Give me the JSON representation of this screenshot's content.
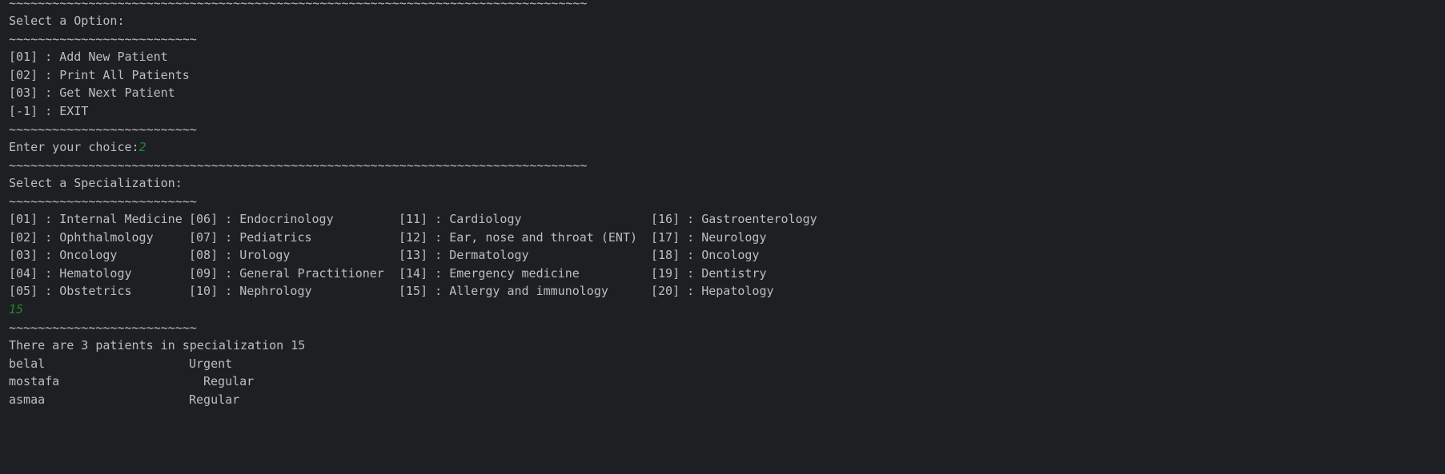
{
  "console": {
    "rule_long": "~~~~~~~~~~~~~~~~~~~~~~~~~~~~~~~~~~~~~~~~~~~~~~~~~~~~~~~~~~~~~~~~~~~~~~~~~~~~~~~~",
    "rule_short": "~~~~~~~~~~~~~~~~~~~~~~~~~~",
    "option_prompt": "Select a Option:",
    "options": [
      "[01] : Add New Patient",
      "[02] : Print All Patients",
      "[03] : Get Next Patient",
      "[-1] : EXIT"
    ],
    "choice_prompt": "Enter your choice:",
    "choice_input": "2",
    "spec_prompt": "Select a Specialization:",
    "specializations": [
      [
        "[01] : Internal Medicine",
        "[06] : Endocrinology",
        "[11] : Cardiology",
        "[16] : Gastroenterology"
      ],
      [
        "[02] : Ophthalmology",
        "[07] : Pediatrics",
        "[12] : Ear, nose and throat (ENT)",
        "[17] : Neurology"
      ],
      [
        "[03] : Oncology",
        "[08] : Urology",
        "[13] : Dermatology",
        "[18] : Oncology"
      ],
      [
        "[04] : Hematology",
        "[09] : General Practitioner",
        "[14] : Emergency medicine",
        "[19] : Dentistry"
      ],
      [
        "[05] : Obstetrics",
        "[10] : Nephrology",
        "[15] : Allergy and immunology",
        "[20] : Hepatology"
      ]
    ],
    "spec_input": "15",
    "result_text": "There are 3 patients in specialization 15",
    "patients": [
      {
        "name": "belal",
        "status": "Urgent"
      },
      {
        "name": "mostafa",
        "status": "Regular"
      },
      {
        "name": "asmaa",
        "status": "Regular"
      }
    ]
  }
}
